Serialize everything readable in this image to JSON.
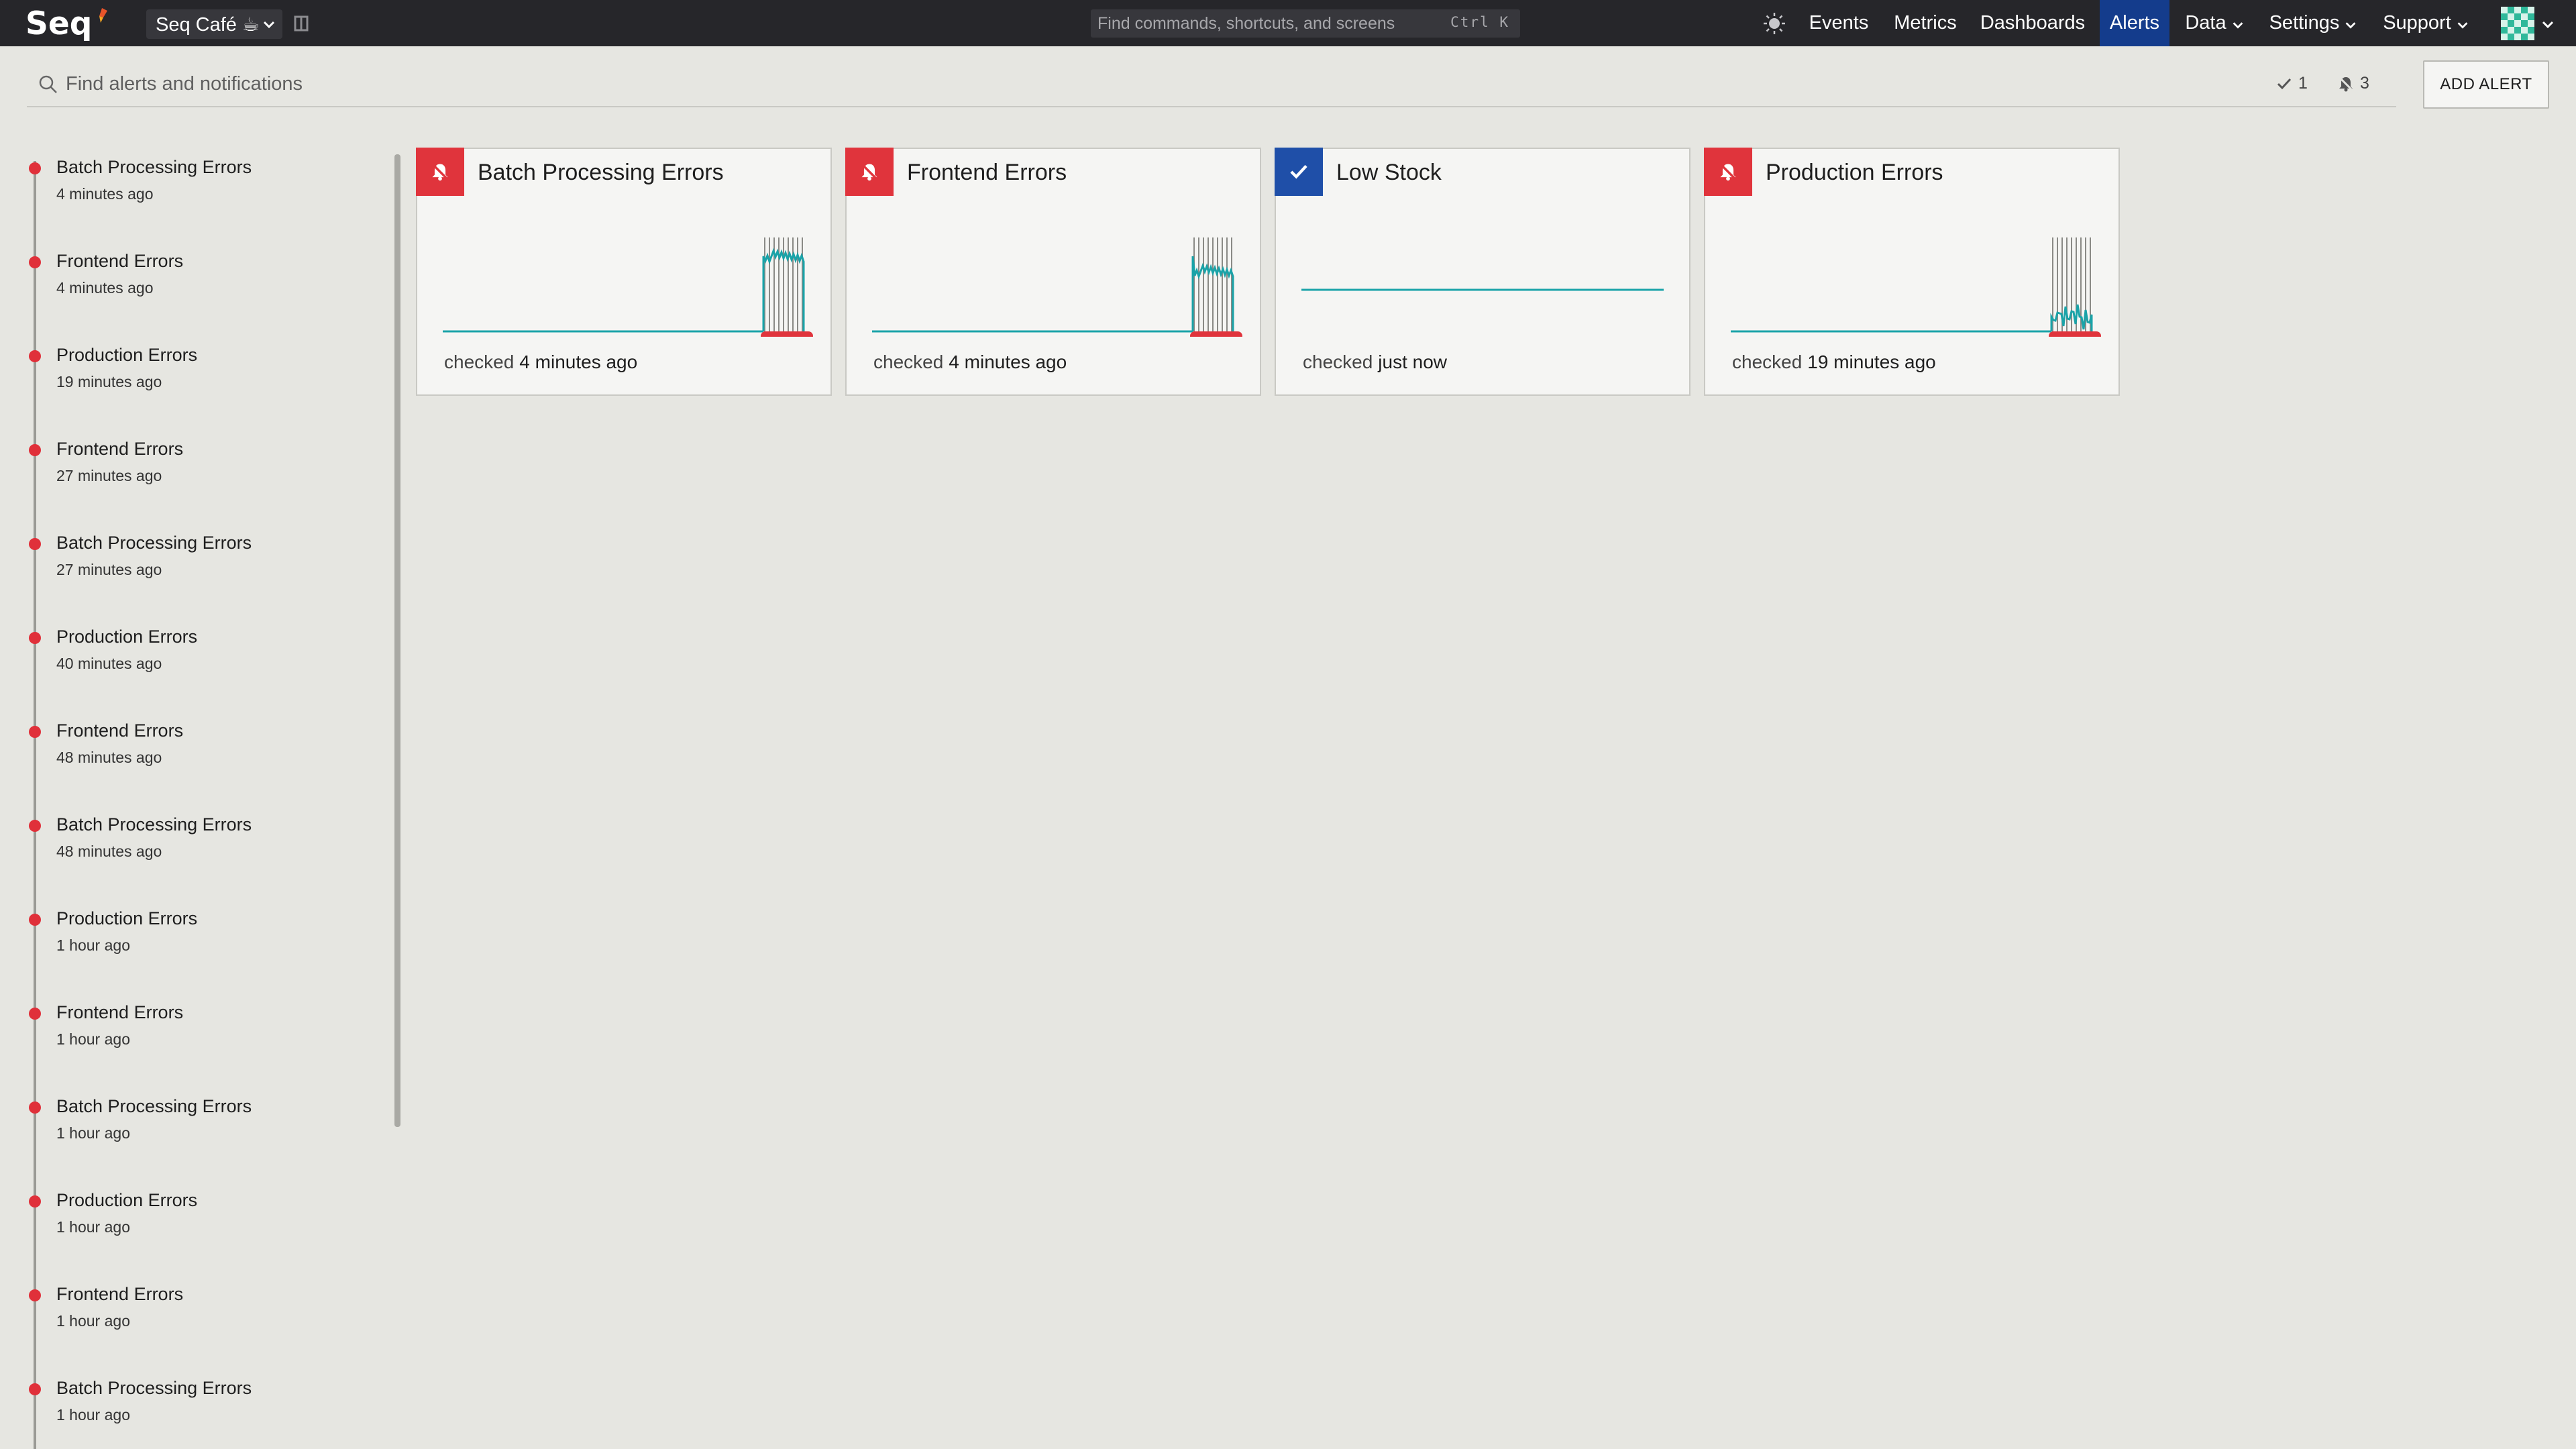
{
  "topbar": {
    "logo_text": "Seq",
    "workspace_label": "Seq Café ☕",
    "command_placeholder": "Find commands, shortcuts, and screens",
    "command_shortcut": "Ctrl K",
    "nav": {
      "events": "Events",
      "metrics": "Metrics",
      "dashboards": "Dashboards",
      "alerts": "Alerts",
      "data": "Data",
      "settings": "Settings",
      "support": "Support"
    },
    "active_nav": "Alerts",
    "active_color": "#143c8c"
  },
  "search": {
    "placeholder": "Find alerts and notifications",
    "value": "",
    "ok_count": "1",
    "firing_count": "3",
    "add_alert_label": "ADD ALERT"
  },
  "timeline": {
    "items": [
      {
        "title": "Batch Processing Errors",
        "time": "4 minutes ago"
      },
      {
        "title": "Frontend Errors",
        "time": "4 minutes ago"
      },
      {
        "title": "Production Errors",
        "time": "19 minutes ago"
      },
      {
        "title": "Frontend Errors",
        "time": "27 minutes ago"
      },
      {
        "title": "Batch Processing Errors",
        "time": "27 minutes ago"
      },
      {
        "title": "Production Errors",
        "time": "40 minutes ago"
      },
      {
        "title": "Frontend Errors",
        "time": "48 minutes ago"
      },
      {
        "title": "Batch Processing Errors",
        "time": "48 minutes ago"
      },
      {
        "title": "Production Errors",
        "time": "1 hour ago"
      },
      {
        "title": "Frontend Errors",
        "time": "1 hour ago"
      },
      {
        "title": "Batch Processing Errors",
        "time": "1 hour ago"
      },
      {
        "title": "Production Errors",
        "time": "1 hour ago"
      },
      {
        "title": "Frontend Errors",
        "time": "1 hour ago"
      },
      {
        "title": "Batch Processing Errors",
        "time": "1 hour ago"
      }
    ]
  },
  "alerts": [
    {
      "title": "Batch Processing Errors",
      "state": "firing",
      "checked_label": "checked",
      "checked_value": "4 minutes ago",
      "icon": "bell-icon"
    },
    {
      "title": "Frontend Errors",
      "state": "firing",
      "checked_label": "checked",
      "checked_value": "4 minutes ago",
      "icon": "bell-icon"
    },
    {
      "title": "Low Stock",
      "state": "ok",
      "checked_label": "checked",
      "checked_value": "just now",
      "icon": "check-icon"
    },
    {
      "title": "Production Errors",
      "state": "firing",
      "checked_label": "checked",
      "checked_value": "19 minutes ago",
      "icon": "bell-icon"
    }
  ],
  "colors": {
    "firing": "#e0343c",
    "ok": "#1f4fa8",
    "sparkline": "#1aa3a8",
    "timeline_dot": "#e0303a"
  }
}
